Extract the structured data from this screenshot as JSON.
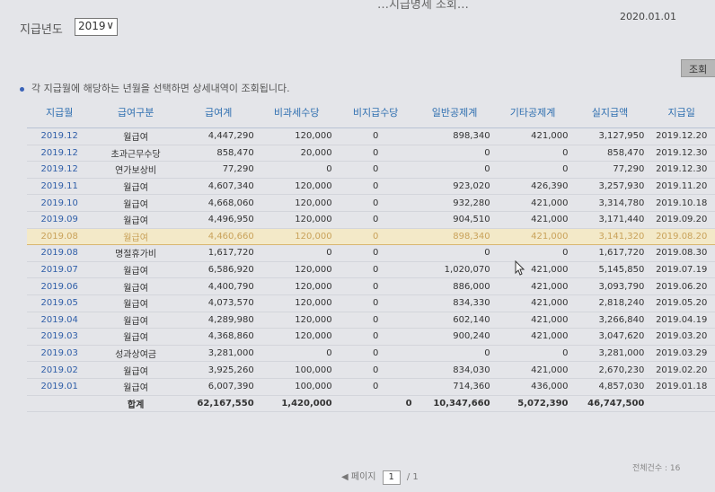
{
  "header": {
    "partial_title": "…지급명세 조회…",
    "date": "2020.01.01",
    "year_label": "지급년도",
    "year_value": "2019",
    "search_button": "조회"
  },
  "info_text": "각 지급월에 해당하는 년월을 선택하면 상세내역이 조회됩니다.",
  "table": {
    "columns": [
      "지급월",
      "급여구분",
      "급여계",
      "비과세수당",
      "비지급수당",
      "일반공제계",
      "기타공제계",
      "실지급액",
      "지급일"
    ],
    "rows": [
      [
        "2019.12",
        "월급여",
        "4,447,290",
        "120,000",
        "0",
        "898,340",
        "421,000",
        "3,127,950",
        "2019.12.20"
      ],
      [
        "2019.12",
        "초과근무수당",
        "858,470",
        "20,000",
        "0",
        "0",
        "0",
        "858,470",
        "2019.12.30"
      ],
      [
        "2019.12",
        "연가보상비",
        "77,290",
        "0",
        "0",
        "0",
        "0",
        "77,290",
        "2019.12.30"
      ],
      [
        "2019.11",
        "월급여",
        "4,607,340",
        "120,000",
        "0",
        "923,020",
        "426,390",
        "3,257,930",
        "2019.11.20"
      ],
      [
        "2019.10",
        "월급여",
        "4,668,060",
        "120,000",
        "0",
        "932,280",
        "421,000",
        "3,314,780",
        "2019.10.18"
      ],
      [
        "2019.09",
        "월급여",
        "4,496,950",
        "120,000",
        "0",
        "904,510",
        "421,000",
        "3,171,440",
        "2019.09.20"
      ],
      [
        "2019.08",
        "월급여",
        "4,460,660",
        "120,000",
        "0",
        "898,340",
        "421,000",
        "3,141,320",
        "2019.08.20"
      ],
      [
        "2019.08",
        "명절휴가비",
        "1,617,720",
        "0",
        "0",
        "0",
        "0",
        "1,617,720",
        "2019.08.30"
      ],
      [
        "2019.07",
        "월급여",
        "6,586,920",
        "120,000",
        "0",
        "1,020,070",
        "421,000",
        "5,145,850",
        "2019.07.19"
      ],
      [
        "2019.06",
        "월급여",
        "4,400,790",
        "120,000",
        "0",
        "886,000",
        "421,000",
        "3,093,790",
        "2019.06.20"
      ],
      [
        "2019.05",
        "월급여",
        "4,073,570",
        "120,000",
        "0",
        "834,330",
        "421,000",
        "2,818,240",
        "2019.05.20"
      ],
      [
        "2019.04",
        "월급여",
        "4,289,980",
        "120,000",
        "0",
        "602,140",
        "421,000",
        "3,266,840",
        "2019.04.19"
      ],
      [
        "2019.03",
        "월급여",
        "4,368,860",
        "120,000",
        "0",
        "900,240",
        "421,000",
        "3,047,620",
        "2019.03.20"
      ],
      [
        "2019.03",
        "성과상여금",
        "3,281,000",
        "0",
        "0",
        "0",
        "0",
        "3,281,000",
        "2019.03.29"
      ],
      [
        "2019.02",
        "월급여",
        "3,925,260",
        "100,000",
        "0",
        "834,030",
        "421,000",
        "2,670,230",
        "2019.02.20"
      ],
      [
        "2019.01",
        "월급여",
        "6,007,390",
        "100,000",
        "0",
        "714,360",
        "436,000",
        "4,857,030",
        "2019.01.18"
      ]
    ],
    "highlight_row": 6,
    "total": [
      "",
      "합계",
      "62,167,550",
      "1,420,000",
      "0",
      "10,347,660",
      "5,072,390",
      "46,747,500",
      ""
    ]
  },
  "pager": {
    "label": "페이지",
    "current": "1",
    "of": "/ 1"
  },
  "total_count": "전체건수 : 16"
}
